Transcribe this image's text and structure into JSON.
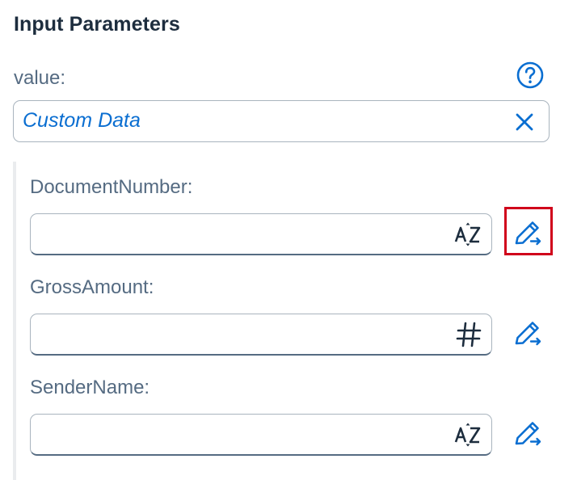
{
  "section": {
    "title": "Input Parameters"
  },
  "value_field": {
    "label": "value:",
    "value": "Custom Data"
  },
  "icons": {
    "help": "help-circle-icon",
    "clear": "close-icon",
    "text_type": "text-type-icon",
    "number_type": "number-type-icon",
    "edit": "edit-mapping-icon"
  },
  "parameters": [
    {
      "label": "DocumentNumber:",
      "value": "",
      "type": "text",
      "highlighted": true
    },
    {
      "label": "GrossAmount:",
      "value": "",
      "type": "number",
      "highlighted": false
    },
    {
      "label": "SenderName:",
      "value": "",
      "type": "text",
      "highlighted": false
    }
  ],
  "colors": {
    "accent": "#0a6ed1",
    "highlight_border": "#d0021b",
    "label": "#556b82",
    "title": "#1d2d3e"
  }
}
